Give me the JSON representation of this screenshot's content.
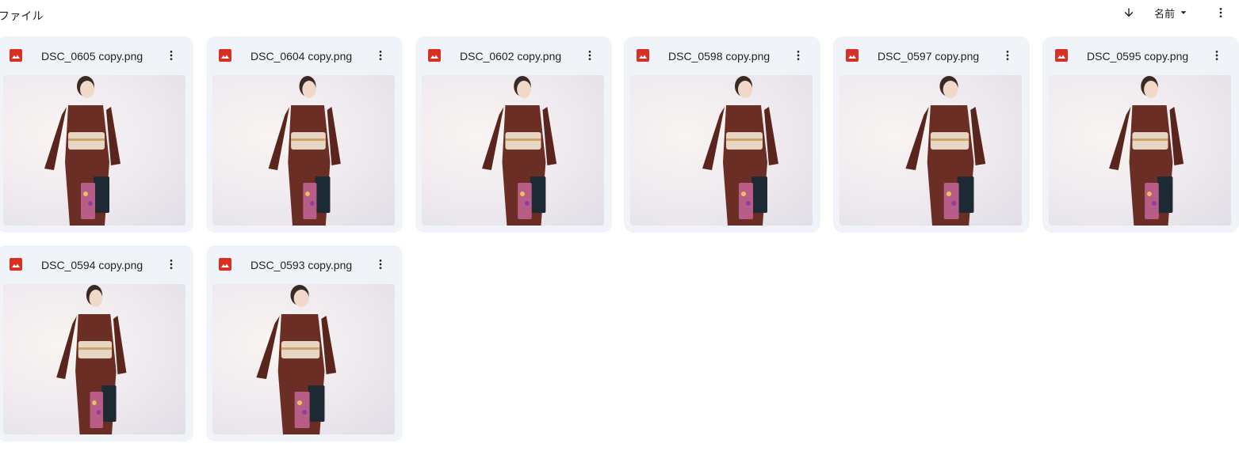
{
  "section": {
    "title": "ファイル"
  },
  "toolbar": {
    "sort_direction_icon": "arrow-down-icon",
    "sort_label": "名前",
    "sort_dropdown_icon": "caret-down-icon",
    "more_icon": "more-vert-icon"
  },
  "colors": {
    "card_bg": "#f0f4f9",
    "image_icon": "#d93025",
    "kimono": "#6b2e24",
    "obi": "#e8d6c4"
  },
  "files": [
    {
      "name": "DSC_0605 copy.png",
      "icon": "image-file-icon"
    },
    {
      "name": "DSC_0604 copy.png",
      "icon": "image-file-icon"
    },
    {
      "name": "DSC_0602 copy.png",
      "icon": "image-file-icon"
    },
    {
      "name": "DSC_0598 copy.png",
      "icon": "image-file-icon"
    },
    {
      "name": "DSC_0597 copy.png",
      "icon": "image-file-icon"
    },
    {
      "name": "DSC_0595 copy.png",
      "icon": "image-file-icon"
    },
    {
      "name": "DSC_0594 copy.png",
      "icon": "image-file-icon"
    },
    {
      "name": "DSC_0593 copy.png",
      "icon": "image-file-icon"
    }
  ]
}
